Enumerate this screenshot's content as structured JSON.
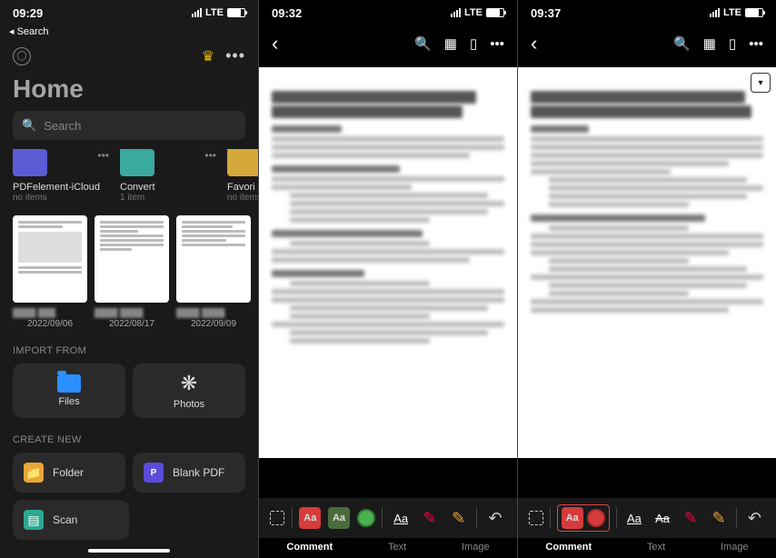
{
  "pane1": {
    "time": "09:29",
    "network": "LTE",
    "back": "Search",
    "title": "Home",
    "search_placeholder": "Search",
    "folders": [
      {
        "name": "PDFelement-iCloud",
        "meta": "no items"
      },
      {
        "name": "Convert",
        "meta": "1 item"
      },
      {
        "name": "Favori",
        "meta": "no items"
      }
    ],
    "docs": [
      {
        "date": "2022/09/06"
      },
      {
        "date": "2022/08/17"
      },
      {
        "date": "2022/09/09"
      }
    ],
    "import_label": "IMPORT FROM",
    "files_label": "Files",
    "photos_label": "Photos",
    "create_label": "CREATE NEW",
    "folder_label": "Folder",
    "blank_label": "Blank PDF",
    "scan_label": "Scan"
  },
  "pane2": {
    "time": "09:32",
    "network": "LTE",
    "tabs": {
      "comment": "Comment",
      "text": "Text",
      "image": "Image"
    }
  },
  "pane3": {
    "time": "09:37",
    "network": "LTE",
    "tabs": {
      "comment": "Comment",
      "text": "Text",
      "image": "Image"
    }
  },
  "tools": {
    "aa": "Aa"
  }
}
